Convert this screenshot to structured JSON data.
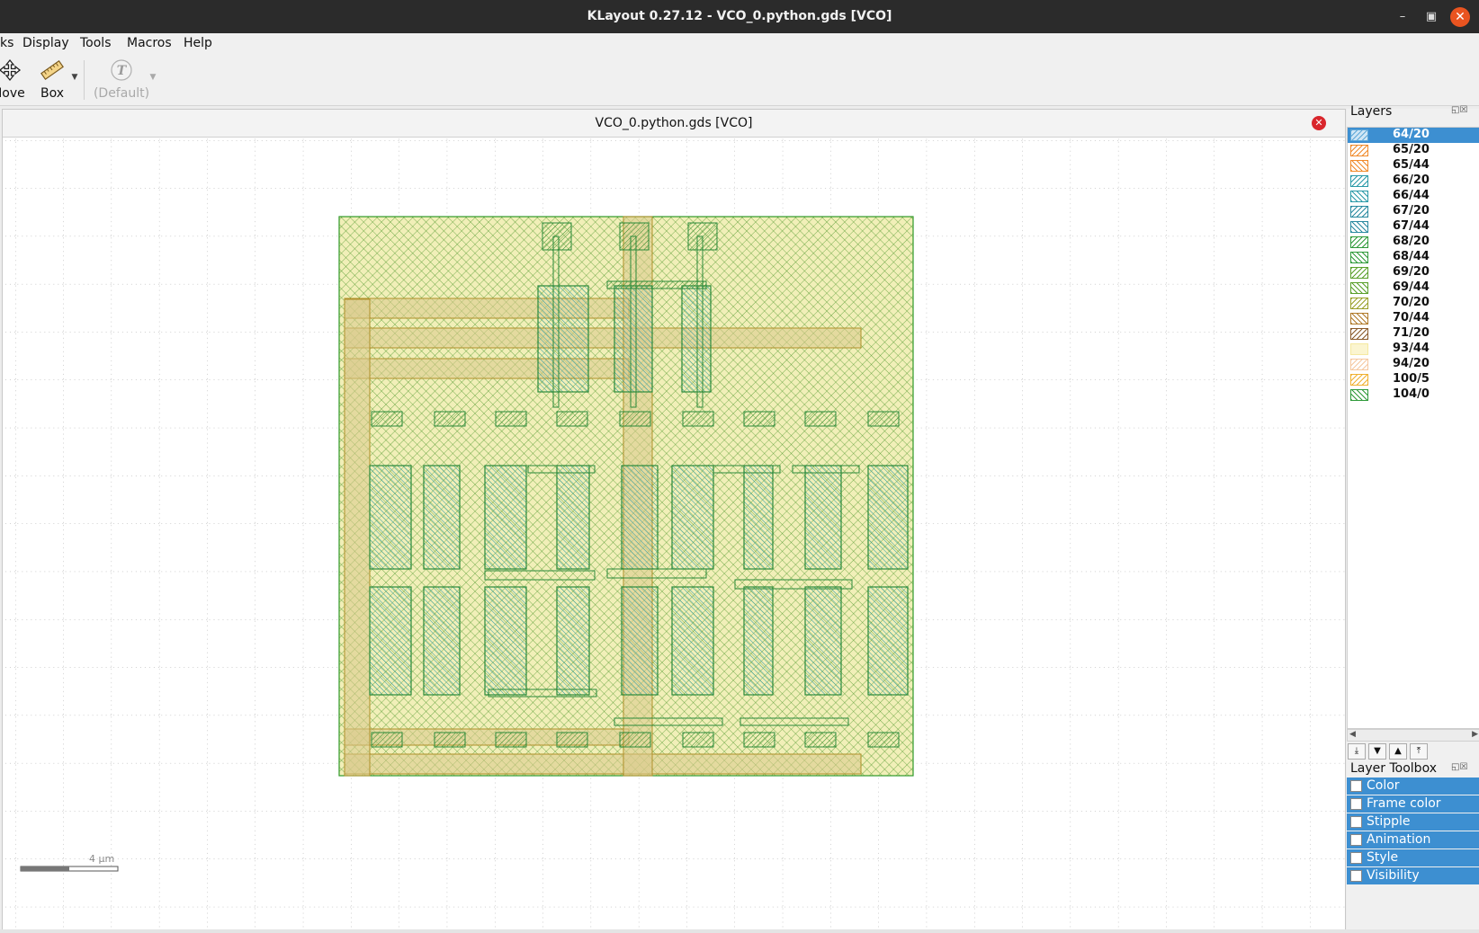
{
  "window": {
    "title": "KLayout 0.27.12 - VCO_0.python.gds [VCO]"
  },
  "menu": {
    "items": [
      "ks",
      "Display",
      "Tools",
      "Macros",
      "Help"
    ]
  },
  "toolbar": {
    "move_label": "Move",
    "box_label": "Box",
    "text_label": "(Default)"
  },
  "document": {
    "tab_title": "VCO_0.python.gds [VCO]"
  },
  "ruler": {
    "label": "4 µm"
  },
  "layers_panel": {
    "title": "Layers",
    "items": [
      {
        "name": "64/20",
        "color": "#5fa8d8"
      },
      {
        "name": "65/20",
        "color": "#f08a2a"
      },
      {
        "name": "65/44",
        "color": "#f08a2a"
      },
      {
        "name": "66/20",
        "color": "#2a9aa8"
      },
      {
        "name": "66/44",
        "color": "#2a9aa8"
      },
      {
        "name": "67/20",
        "color": "#2a8aa0"
      },
      {
        "name": "67/44",
        "color": "#2a8aa0"
      },
      {
        "name": "68/20",
        "color": "#2f9a3a"
      },
      {
        "name": "68/44",
        "color": "#2f9a3a"
      },
      {
        "name": "69/20",
        "color": "#5aa02a"
      },
      {
        "name": "69/44",
        "color": "#5aa02a"
      },
      {
        "name": "70/20",
        "color": "#9aa02a"
      },
      {
        "name": "70/44",
        "color": "#b07a2a"
      },
      {
        "name": "71/20",
        "color": "#8a5a2a"
      },
      {
        "name": "93/44",
        "color": "#f5e9a0"
      },
      {
        "name": "94/20",
        "color": "#f5c8a0"
      },
      {
        "name": "100/5",
        "color": "#f0b030"
      },
      {
        "name": "104/0",
        "color": "#2f9a3a"
      }
    ]
  },
  "layer_toolbox": {
    "title": "Layer Toolbox",
    "items": [
      "Color",
      "Frame color",
      "Stipple",
      "Animation",
      "Style",
      "Visibility"
    ]
  }
}
